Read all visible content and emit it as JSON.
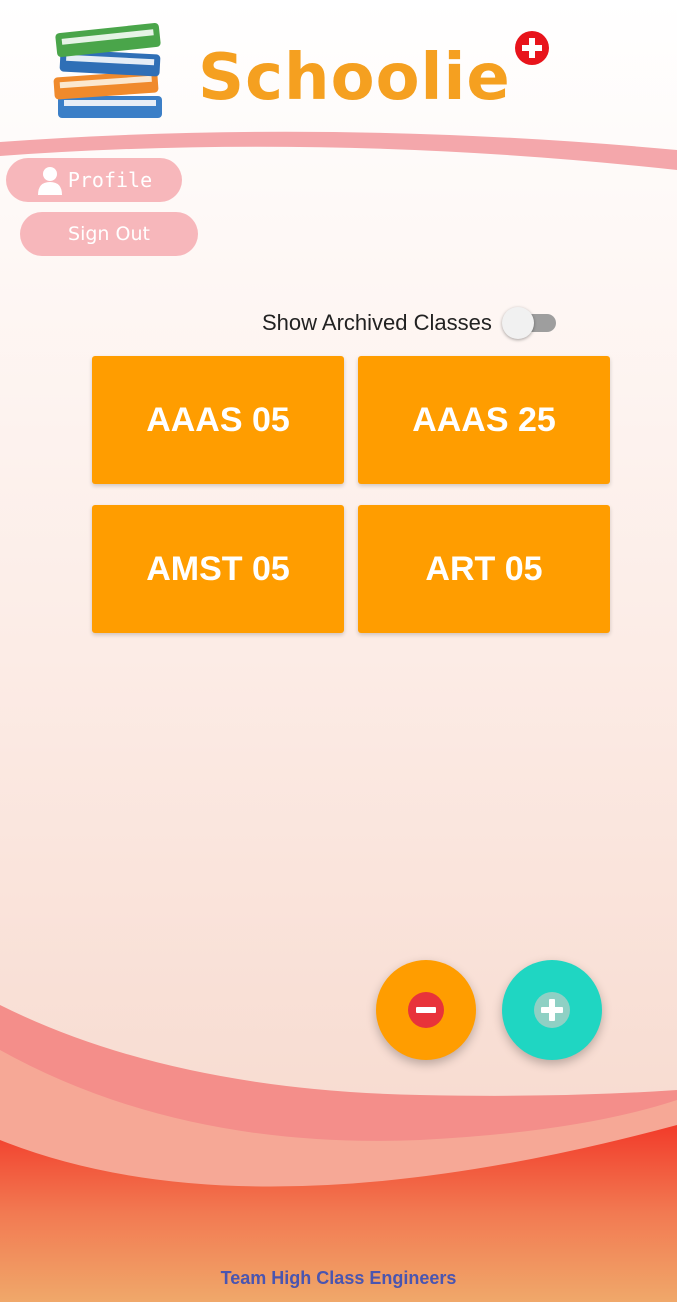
{
  "app": {
    "title": "Schoolie",
    "title_color": "#f5a020",
    "badge_color": "#e8141b"
  },
  "header": {
    "profile_label": "Profile",
    "signout_label": "Sign Out",
    "pill_color": "#f7b7bb"
  },
  "archive": {
    "label": "Show Archived Classes",
    "toggle_on": false
  },
  "classes": [
    {
      "name": "AAAS 05"
    },
    {
      "name": "AAAS 25"
    },
    {
      "name": "AMST 05"
    },
    {
      "name": "ART 05"
    }
  ],
  "card_color": "#ff9d00",
  "fabs": {
    "remove": {
      "icon": "minus-icon",
      "color": "#ff9d00",
      "inner_color": "#e8333a"
    },
    "add": {
      "icon": "plus-icon",
      "color": "#1fd6c2",
      "inner_color": "#8fd0c4"
    }
  },
  "footer": {
    "text": "Team High Class Engineers",
    "color": "#4a55b0"
  }
}
